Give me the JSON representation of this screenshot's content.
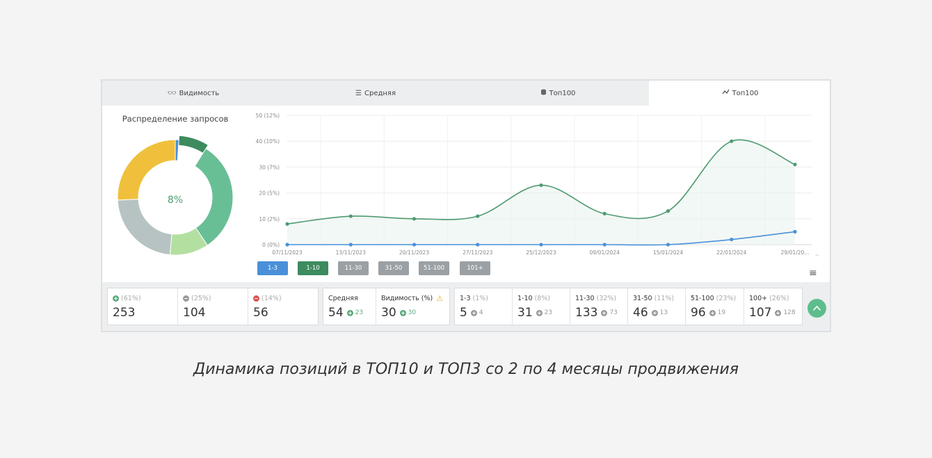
{
  "tabs": [
    {
      "label": "Видимость",
      "icon": "glasses-icon"
    },
    {
      "label": "Средняя",
      "icon": "list-icon"
    },
    {
      "label": "Топ100",
      "icon": "database-icon"
    },
    {
      "label": "Топ100",
      "icon": "chart-line-icon"
    }
  ],
  "active_tab": 3,
  "donut": {
    "title": "Распределение запросов",
    "center_label": "8%",
    "segments": [
      {
        "value": 1,
        "color": "#4a90d9"
      },
      {
        "value": 8,
        "color": "#3d8b5f"
      },
      {
        "value": 32,
        "color": "#68bf95"
      },
      {
        "value": 11,
        "color": "#b3e0a0"
      },
      {
        "value": 23,
        "color": "#b7c3c2"
      },
      {
        "value": 26,
        "color": "#f0c03c"
      }
    ]
  },
  "chart_data": {
    "type": "line",
    "x": [
      "07/11/2023",
      "13/11/2023",
      "20/11/2023",
      "27/11/2023",
      "25/12/2023",
      "09/01/2024",
      "15/01/2024",
      "22/01/2024",
      "29/01/20..."
    ],
    "series": [
      {
        "values": [
          8,
          11,
          10,
          11,
          23,
          12,
          13,
          40,
          31
        ],
        "color": "#4e9a70"
      },
      {
        "values": [
          0,
          0,
          0,
          0,
          0,
          0,
          0,
          2,
          5
        ],
        "color": "#4a90d9"
      }
    ],
    "y_ticks": [
      "0 (0%)",
      "10 (2%)",
      "20 (5%)",
      "30 (7%)",
      "40 (10%)",
      "50 (12%)"
    ],
    "ylim": [
      0,
      50
    ],
    "grid": true
  },
  "range_buttons": [
    {
      "label": "1-3",
      "color": "#4a90d9"
    },
    {
      "label": "1-10",
      "color": "#3d8b5f"
    },
    {
      "label": "11-30",
      "color": "#9aa0a4"
    },
    {
      "label": "31-50",
      "color": "#9aa0a4"
    },
    {
      "label": "51-100",
      "color": "#9aa0a4"
    },
    {
      "label": "101+",
      "color": "#9aa0a4"
    }
  ],
  "stats": {
    "up": {
      "pct": "(61%)",
      "value": "253"
    },
    "same": {
      "pct": "(25%)",
      "value": "104"
    },
    "down": {
      "pct": "(14%)",
      "value": "56"
    },
    "avg": {
      "label": "Средняя",
      "value": "54",
      "delta": "23"
    },
    "vis": {
      "label": "Видимость (%)",
      "value": "30",
      "delta": "30"
    },
    "ranges": [
      {
        "label": "1-3",
        "pct": "(1%)",
        "value": "5",
        "delta": "4"
      },
      {
        "label": "1-10",
        "pct": "(8%)",
        "value": "31",
        "delta": "23"
      },
      {
        "label": "11-30",
        "pct": "(32%)",
        "value": "133",
        "delta": "73"
      },
      {
        "label": "31-50",
        "pct": "(11%)",
        "value": "46",
        "delta": "13"
      },
      {
        "label": "51-100",
        "pct": "(23%)",
        "value": "96",
        "delta": "19"
      },
      {
        "label": "100+",
        "pct": "(26%)",
        "value": "107",
        "delta": "128"
      }
    ]
  },
  "colors": {
    "green": "#5aaa7d",
    "grey": "#999999",
    "red": "#d9534f",
    "warning": "#e3b62b"
  },
  "caption": "Динамика позиций в ТОП10 и ТОП3 со 2 по 4 месяцы продвижения"
}
